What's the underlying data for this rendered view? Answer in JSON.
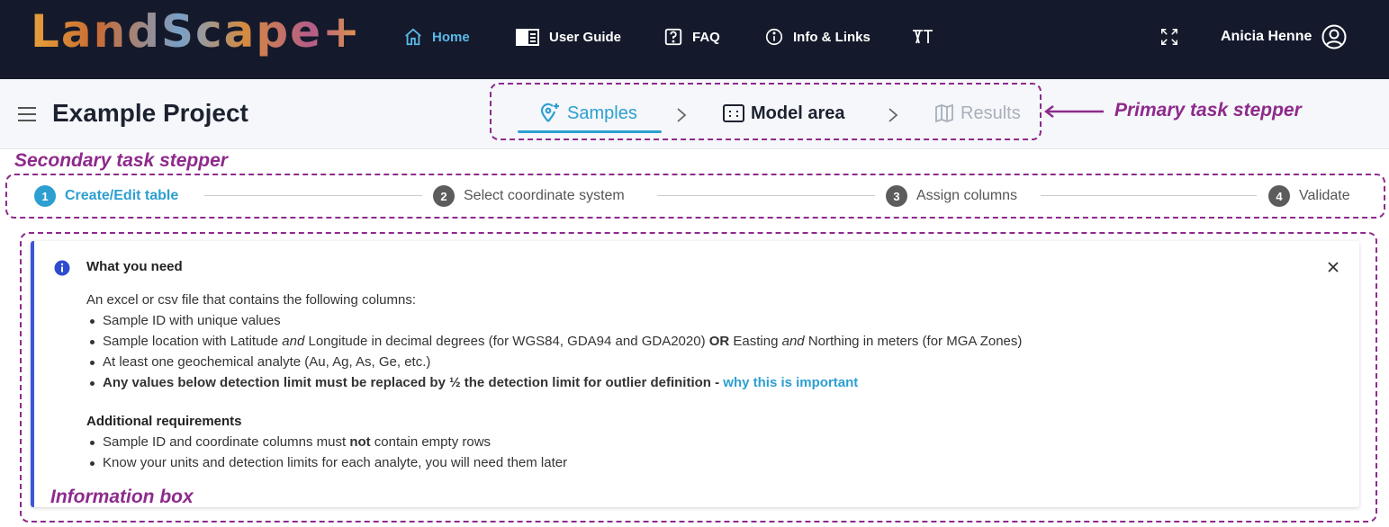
{
  "nav": {
    "logo": "LandScape+",
    "items": [
      {
        "label": "Home",
        "icon": "home-icon"
      },
      {
        "label": "User Guide",
        "icon": "book-icon"
      },
      {
        "label": "FAQ",
        "icon": "help-square-icon"
      },
      {
        "label": "Info & Links",
        "icon": "info-circle-icon"
      },
      {
        "label": "",
        "icon": "translate-icon"
      }
    ],
    "fullscreen_icon": "expand-icon",
    "user_name": "Anicia Henne",
    "user_icon": "user-circle-icon"
  },
  "project": {
    "title": "Example Project",
    "menu_icon": "hamburger-icon",
    "primary_steps": [
      {
        "label": "Samples",
        "icon": "location-plus-icon",
        "state": "active"
      },
      {
        "label": "Model area",
        "icon": "area-select-icon",
        "state": "normal"
      },
      {
        "label": "Results",
        "icon": "map-icon",
        "state": "disabled"
      }
    ]
  },
  "secondary_steps": [
    {
      "number": "1",
      "label": "Create/Edit table",
      "state": "active"
    },
    {
      "number": "2",
      "label": "Select coordinate system",
      "state": "inactive"
    },
    {
      "number": "3",
      "label": "Assign columns",
      "state": "inactive"
    },
    {
      "number": "4",
      "label": "Validate",
      "state": "inactive"
    }
  ],
  "info": {
    "heading": "What you need",
    "intro": "An excel or csv file that contains the following columns:",
    "item1": "Sample ID with unique values",
    "item2": {
      "a": "Sample location with Latitude ",
      "and1": "and",
      "b": " Longitude in decimal degrees (for WGS84, GDA94 and GDA2020) ",
      "or": "OR",
      "c": " Easting ",
      "and2": "and",
      "d": " Northing in meters (for MGA Zones)"
    },
    "item3": "At least one geochemical analyte (Au, Ag, As, Ge, etc.)",
    "item4": {
      "text": "Any values below detection limit must be replaced by ½ the detection limit for outlier definition - ",
      "link": "why this is important"
    },
    "req_heading": "Additional requirements",
    "req1": {
      "a": "Sample ID and coordinate columns must ",
      "not": "not",
      "b": " contain empty rows"
    },
    "req2": "Know your units and detection limits for each analyte, you will need them later"
  },
  "annotations": {
    "primary": "Primary task stepper",
    "secondary": "Secondary task stepper",
    "info": "Information box"
  },
  "colors": {
    "navbar": "#141a2b",
    "accent": "#2d9fd0",
    "annotation": "#8e2a8c",
    "info_border": "#3a56d6"
  }
}
